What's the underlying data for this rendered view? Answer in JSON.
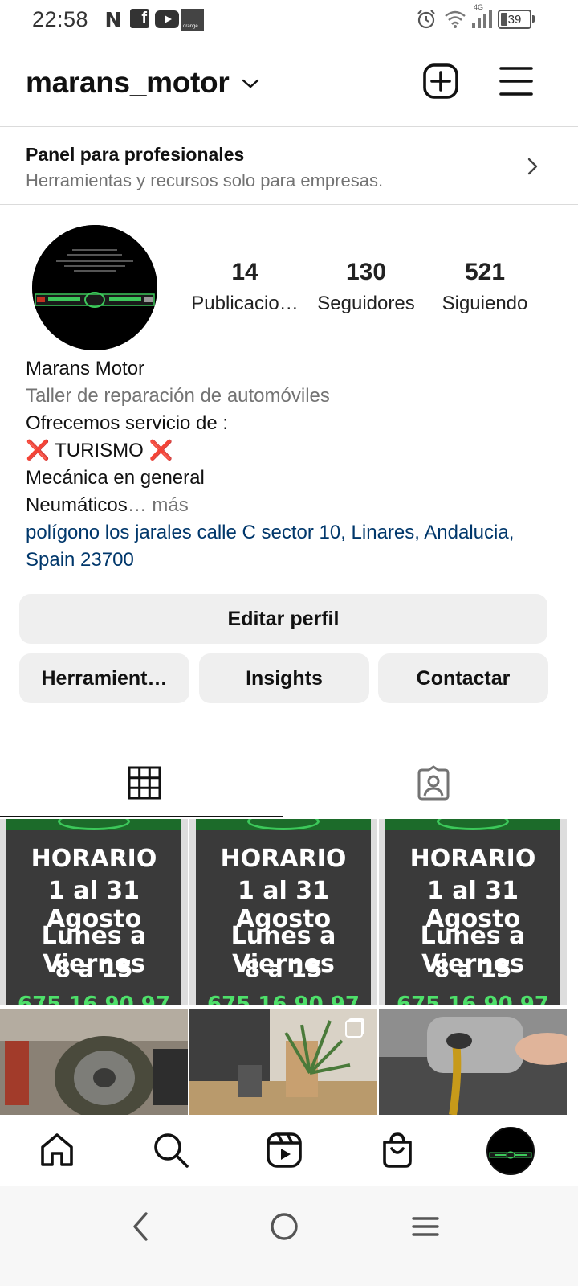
{
  "status_bar": {
    "time": "22:58",
    "notification_icons": [
      "netflix-icon",
      "facebook-icon",
      "youtube-icon",
      "orange-icon"
    ],
    "orange_label": "orange",
    "network_label": "4G",
    "battery_level": "39"
  },
  "header": {
    "username": "marans_motor"
  },
  "pro_panel": {
    "title": "Panel para profesionales",
    "subtitle": "Herramientas y recursos solo para empresas."
  },
  "profile": {
    "stats": [
      {
        "value": "14",
        "label": "Publicacio…"
      },
      {
        "value": "130",
        "label": "Seguidores"
      },
      {
        "value": "521",
        "label": "Siguiendo"
      }
    ],
    "name": "Marans Motor",
    "category": "Taller de reparación de automóviles",
    "bio_lines": [
      "Ofrecemos servicio de :",
      "TURISMO",
      "Mecánica en general",
      "Neumáticos"
    ],
    "bio_emoji": "❌",
    "more_label": "… más",
    "address": "polígono los jarales calle C sector 10, Linares, Andalucia, Spain 23700"
  },
  "buttons": {
    "edit_profile": "Editar perfil",
    "tools": "Herramient…",
    "insights": "Insights",
    "contact": "Contactar"
  },
  "posts": {
    "poster_lines": [
      "HORARIO",
      "1 al 31 Agosto",
      "Lunes a Viernes",
      "8 a 15",
      "675 16 90 97"
    ]
  },
  "colors": {
    "link": "#00376b",
    "secondary_text": "#737373",
    "button_bg": "#efefef",
    "divider": "#dbdbdb"
  }
}
